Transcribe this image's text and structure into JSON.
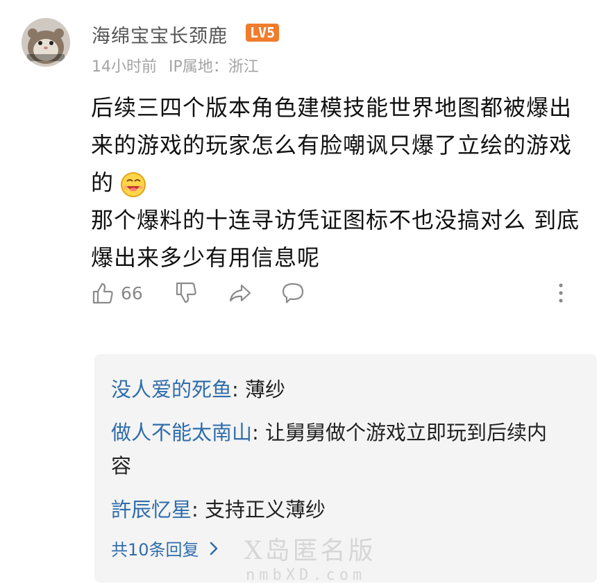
{
  "comment": {
    "username": "海绵宝宝长颈鹿",
    "level_badge": "LV5",
    "time": "14小时前",
    "ip_location": "IP属地：浙江",
    "body_lines": [
      "后续三四个版本角色建模技能世界地图都被爆出",
      "来的游戏的玩家怎么有脸嘲讽只爆了立绘的游戏",
      "的",
      "那个爆料的十连寻访凭证图标不也没搞对么 到底",
      "爆出来多少有用信息呢"
    ],
    "emoji_icon": "grinning-face-emoji",
    "likes": "66"
  },
  "replies": [
    {
      "author": "没人爱的死鱼",
      "sep": ": ",
      "text": "薄纱"
    },
    {
      "author": "做人不能太南山",
      "sep": ": ",
      "text": "让舅舅做个游戏立即玩到后续内容"
    },
    {
      "author": "許辰忆星",
      "sep": ": ",
      "text": "支持正义薄纱"
    }
  ],
  "more_replies": "共10条回复",
  "watermark": {
    "line1": "X岛匿名版",
    "line2": "nmbXD.com"
  },
  "colors": {
    "link": "#2e6dab",
    "badge": "#f07c2c",
    "meta": "#a3a3a3"
  }
}
